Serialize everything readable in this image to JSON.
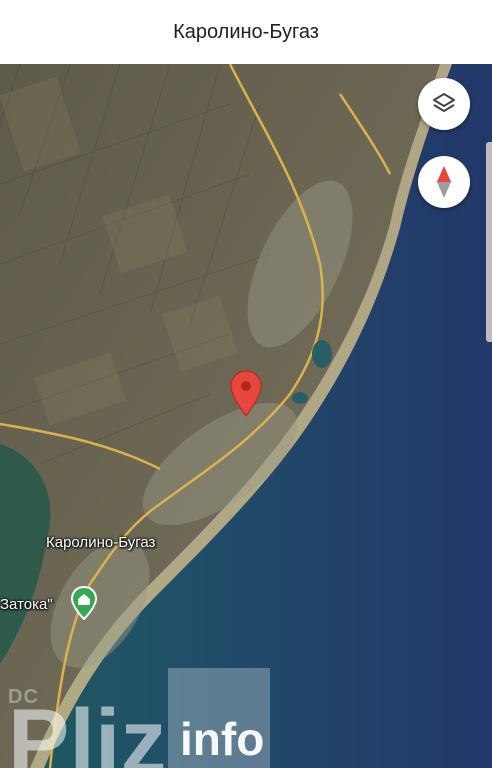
{
  "header": {
    "title": "Каролино-Бугаз"
  },
  "controls": {
    "layers_icon": "layers-icon",
    "compass_icon": "compass-icon"
  },
  "map": {
    "labels": {
      "city": "Каролино-Бугаз",
      "poi": "Затока\""
    },
    "colors": {
      "sea_deep": "#22376a",
      "sea_shallow": "#1e5f63",
      "land": "#6e6a55",
      "road": "#d9b44a",
      "pin_red": "#e8453c",
      "poi_green": "#34a853"
    }
  },
  "watermark": {
    "small": "DC",
    "big": "Pliz",
    "info": "info"
  }
}
